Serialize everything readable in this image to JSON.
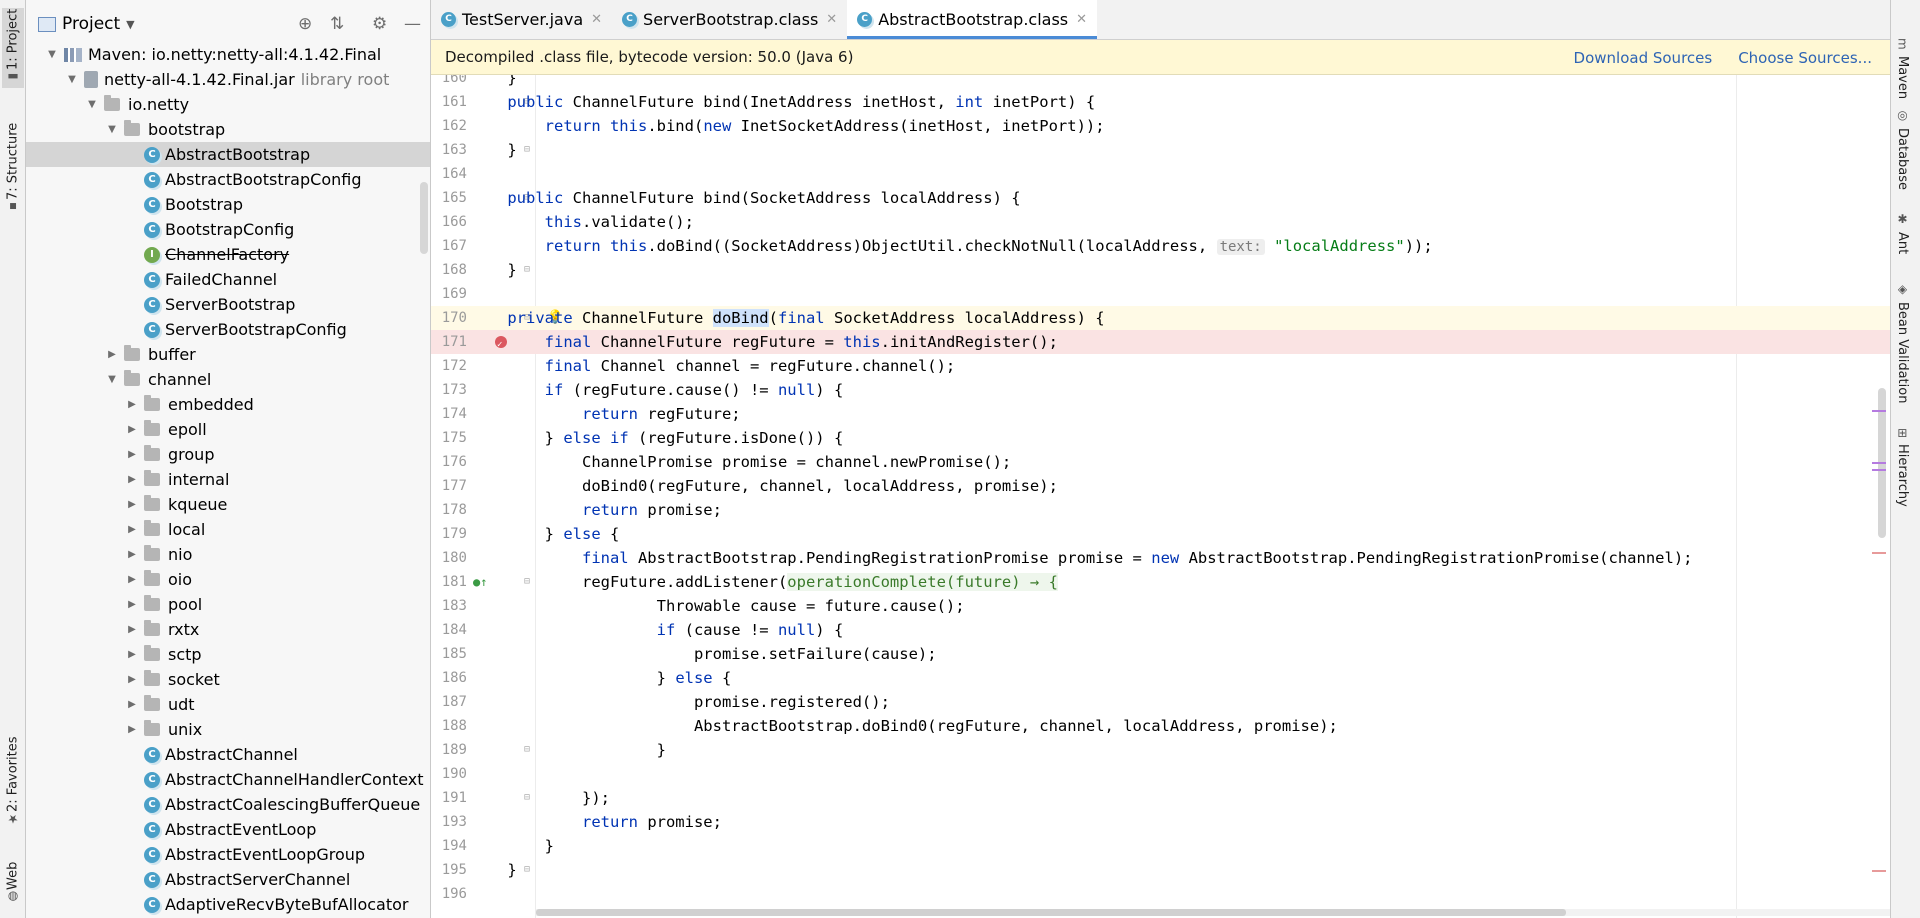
{
  "left_strip": {
    "project_tab": "1: Project",
    "structure_tab": "7: Structure",
    "favorites_tab": "2: Favorites",
    "web_tab": "Web"
  },
  "project_panel": {
    "title": "Project",
    "tree": [
      {
        "label": "Maven: io.netty:netty-all:4.1.42.Final",
        "kind": "library",
        "depth": 0,
        "expanded": true
      },
      {
        "label": "netty-all-4.1.42.Final.jar",
        "suffix": "library root",
        "kind": "jar",
        "depth": 1,
        "expanded": true
      },
      {
        "label": "io.netty",
        "kind": "package",
        "depth": 2,
        "expanded": true
      },
      {
        "label": "bootstrap",
        "kind": "package",
        "depth": 3,
        "expanded": true
      },
      {
        "label": "AbstractBootstrap",
        "kind": "class",
        "depth": 4,
        "selected": true
      },
      {
        "label": "AbstractBootstrapConfig",
        "kind": "class",
        "depth": 4
      },
      {
        "label": "Bootstrap",
        "kind": "class",
        "depth": 4
      },
      {
        "label": "BootstrapConfig",
        "kind": "class",
        "depth": 4
      },
      {
        "label": "ChannelFactory",
        "kind": "interface",
        "depth": 4,
        "deprecated": true
      },
      {
        "label": "FailedChannel",
        "kind": "class",
        "depth": 4
      },
      {
        "label": "ServerBootstrap",
        "kind": "class",
        "depth": 4
      },
      {
        "label": "ServerBootstrapConfig",
        "kind": "class",
        "depth": 4
      },
      {
        "label": "buffer",
        "kind": "package",
        "depth": 3,
        "expanded": false
      },
      {
        "label": "channel",
        "kind": "package",
        "depth": 3,
        "expanded": true
      },
      {
        "label": "embedded",
        "kind": "package",
        "depth": 4,
        "expanded": false
      },
      {
        "label": "epoll",
        "kind": "package",
        "depth": 4,
        "expanded": false
      },
      {
        "label": "group",
        "kind": "package",
        "depth": 4,
        "expanded": false
      },
      {
        "label": "internal",
        "kind": "package",
        "depth": 4,
        "expanded": false
      },
      {
        "label": "kqueue",
        "kind": "package",
        "depth": 4,
        "expanded": false
      },
      {
        "label": "local",
        "kind": "package",
        "depth": 4,
        "expanded": false
      },
      {
        "label": "nio",
        "kind": "package",
        "depth": 4,
        "expanded": false
      },
      {
        "label": "oio",
        "kind": "package",
        "depth": 4,
        "expanded": false
      },
      {
        "label": "pool",
        "kind": "package",
        "depth": 4,
        "expanded": false
      },
      {
        "label": "rxtx",
        "kind": "package",
        "depth": 4,
        "expanded": false
      },
      {
        "label": "sctp",
        "kind": "package",
        "depth": 4,
        "expanded": false
      },
      {
        "label": "socket",
        "kind": "package",
        "depth": 4,
        "expanded": false
      },
      {
        "label": "udt",
        "kind": "package",
        "depth": 4,
        "expanded": false
      },
      {
        "label": "unix",
        "kind": "package",
        "depth": 4,
        "expanded": false
      },
      {
        "label": "AbstractChannel",
        "kind": "class",
        "depth": 4
      },
      {
        "label": "AbstractChannelHandlerContext",
        "kind": "class",
        "depth": 4
      },
      {
        "label": "AbstractCoalescingBufferQueue",
        "kind": "class",
        "depth": 4
      },
      {
        "label": "AbstractEventLoop",
        "kind": "class",
        "depth": 4
      },
      {
        "label": "AbstractEventLoopGroup",
        "kind": "class",
        "depth": 4
      },
      {
        "label": "AbstractServerChannel",
        "kind": "class",
        "depth": 4
      },
      {
        "label": "AdaptiveRecvByteBufAllocator",
        "kind": "class",
        "depth": 4
      }
    ]
  },
  "editor": {
    "tabs": [
      {
        "label": "TestServer.java",
        "active": false
      },
      {
        "label": "ServerBootstrap.class",
        "active": false
      },
      {
        "label": "AbstractBootstrap.class",
        "active": true
      }
    ],
    "banner": {
      "text": "Decompiled .class file, bytecode version: 50.0 (Java 6)",
      "download_sources": "Download Sources",
      "choose_sources": "Choose Sources..."
    },
    "lines": [
      {
        "n": "160",
        "segs": [
          {
            "t": "    }"
          }
        ]
      },
      {
        "n": "161",
        "segs": [
          {
            "t": "    public ",
            "c": "kw"
          },
          {
            "t": "ChannelFuture bind(InetAddress inetHost, "
          },
          {
            "t": "int",
            "c": "kw"
          },
          {
            "t": " inetPort) {"
          }
        ]
      },
      {
        "n": "162",
        "segs": [
          {
            "t": "        return this",
            "c": "kw"
          },
          {
            "t": ".bind("
          },
          {
            "t": "new",
            "c": "kw"
          },
          {
            "t": " InetSocketAddress(inetHost, inetPort));"
          }
        ]
      },
      {
        "n": "163",
        "segs": [
          {
            "t": "    }"
          }
        ]
      },
      {
        "n": "164",
        "segs": [
          {
            "t": ""
          }
        ]
      },
      {
        "n": "165",
        "segs": [
          {
            "t": "    public ",
            "c": "kw"
          },
          {
            "t": "ChannelFuture bind(SocketAddress localAddress) {"
          }
        ]
      },
      {
        "n": "166",
        "segs": [
          {
            "t": "        this",
            "c": "kw"
          },
          {
            "t": ".validate();"
          }
        ]
      },
      {
        "n": "167",
        "segs": [
          {
            "t": "        return this",
            "c": "kw"
          },
          {
            "t": ".doBind((SocketAddress)ObjectUtil.checkNotNull(localAddress, "
          },
          {
            "t": "text:",
            "c": "hint"
          },
          {
            "t": " "
          },
          {
            "t": "\"localAddress\"",
            "c": "str"
          },
          {
            "t": "));"
          }
        ]
      },
      {
        "n": "168",
        "segs": [
          {
            "t": "    }"
          }
        ]
      },
      {
        "n": "169",
        "segs": [
          {
            "t": ""
          }
        ]
      },
      {
        "n": "170",
        "segs": [
          {
            "t": "    private ",
            "c": "kw"
          },
          {
            "t": "ChannelFuture "
          },
          {
            "t": "doBind",
            "c": "hl"
          },
          {
            "t": "("
          },
          {
            "t": "final",
            "c": "kw"
          },
          {
            "t": " SocketAddress localAddress) {"
          }
        ]
      },
      {
        "n": "171",
        "segs": [
          {
            "t": "        final",
            "c": "kw"
          },
          {
            "t": " ChannelFuture regFuture = "
          },
          {
            "t": "this",
            "c": "kw"
          },
          {
            "t": ".initAndRegister();"
          }
        ]
      },
      {
        "n": "172",
        "segs": [
          {
            "t": "        final",
            "c": "kw"
          },
          {
            "t": " Channel channel = regFuture.channel();"
          }
        ]
      },
      {
        "n": "173",
        "segs": [
          {
            "t": "        if",
            "c": "kw"
          },
          {
            "t": " (regFuture.cause() != "
          },
          {
            "t": "null",
            "c": "kw"
          },
          {
            "t": ") {"
          }
        ]
      },
      {
        "n": "174",
        "segs": [
          {
            "t": "            return",
            "c": "kw"
          },
          {
            "t": " regFuture;"
          }
        ]
      },
      {
        "n": "175",
        "segs": [
          {
            "t": "        } "
          },
          {
            "t": "else if",
            "c": "kw"
          },
          {
            "t": " (regFuture.isDone()) {"
          }
        ]
      },
      {
        "n": "176",
        "segs": [
          {
            "t": "            ChannelPromise promise = channel.newPromise();"
          }
        ]
      },
      {
        "n": "177",
        "segs": [
          {
            "t": "            doBind0(regFuture, channel, localAddress, promise);"
          }
        ]
      },
      {
        "n": "178",
        "segs": [
          {
            "t": "            return",
            "c": "kw"
          },
          {
            "t": " promise;"
          }
        ]
      },
      {
        "n": "179",
        "segs": [
          {
            "t": "        } "
          },
          {
            "t": "else",
            "c": "kw"
          },
          {
            "t": " {"
          }
        ]
      },
      {
        "n": "180",
        "segs": [
          {
            "t": "            final",
            "c": "kw"
          },
          {
            "t": " AbstractBootstrap.PendingRegistrationPromise promise = "
          },
          {
            "t": "new",
            "c": "kw"
          },
          {
            "t": " AbstractBootstrap.PendingRegistrationPromise(channel);"
          }
        ]
      },
      {
        "n": "181",
        "segs": [
          {
            "t": "            regFuture.addListener("
          },
          {
            "t": "operationComplete(future) → {",
            "c": "lamb"
          }
        ]
      },
      {
        "n": "183",
        "segs": [
          {
            "t": "                    Throwable cause = future.cause();"
          }
        ]
      },
      {
        "n": "184",
        "segs": [
          {
            "t": "                    if",
            "c": "kw"
          },
          {
            "t": " (cause != "
          },
          {
            "t": "null",
            "c": "kw"
          },
          {
            "t": ") {"
          }
        ]
      },
      {
        "n": "185",
        "segs": [
          {
            "t": "                        promise.setFailure(cause);"
          }
        ]
      },
      {
        "n": "186",
        "segs": [
          {
            "t": "                    } "
          },
          {
            "t": "else",
            "c": "kw"
          },
          {
            "t": " {"
          }
        ]
      },
      {
        "n": "187",
        "segs": [
          {
            "t": "                        promise.registered();"
          }
        ]
      },
      {
        "n": "188",
        "segs": [
          {
            "t": "                        AbstractBootstrap.doBind0(regFuture, channel, localAddress, promise);"
          }
        ]
      },
      {
        "n": "189",
        "segs": [
          {
            "t": "                    }"
          }
        ]
      },
      {
        "n": "190",
        "segs": [
          {
            "t": ""
          }
        ]
      },
      {
        "n": "191",
        "segs": [
          {
            "t": "            });"
          }
        ]
      },
      {
        "n": "193",
        "segs": [
          {
            "t": "            return",
            "c": "kw"
          },
          {
            "t": " promise;"
          }
        ]
      },
      {
        "n": "194",
        "segs": [
          {
            "t": "        }"
          }
        ]
      },
      {
        "n": "195",
        "segs": [
          {
            "t": "    }"
          }
        ]
      },
      {
        "n": "196",
        "segs": [
          {
            "t": ""
          }
        ]
      }
    ]
  },
  "right_strip": {
    "maven_tab": "Maven",
    "database_tab": "Database",
    "ant_tab": "Ant",
    "bean_validation_tab": "Bean Validation",
    "hierarchy_tab": "Hierarchy"
  }
}
